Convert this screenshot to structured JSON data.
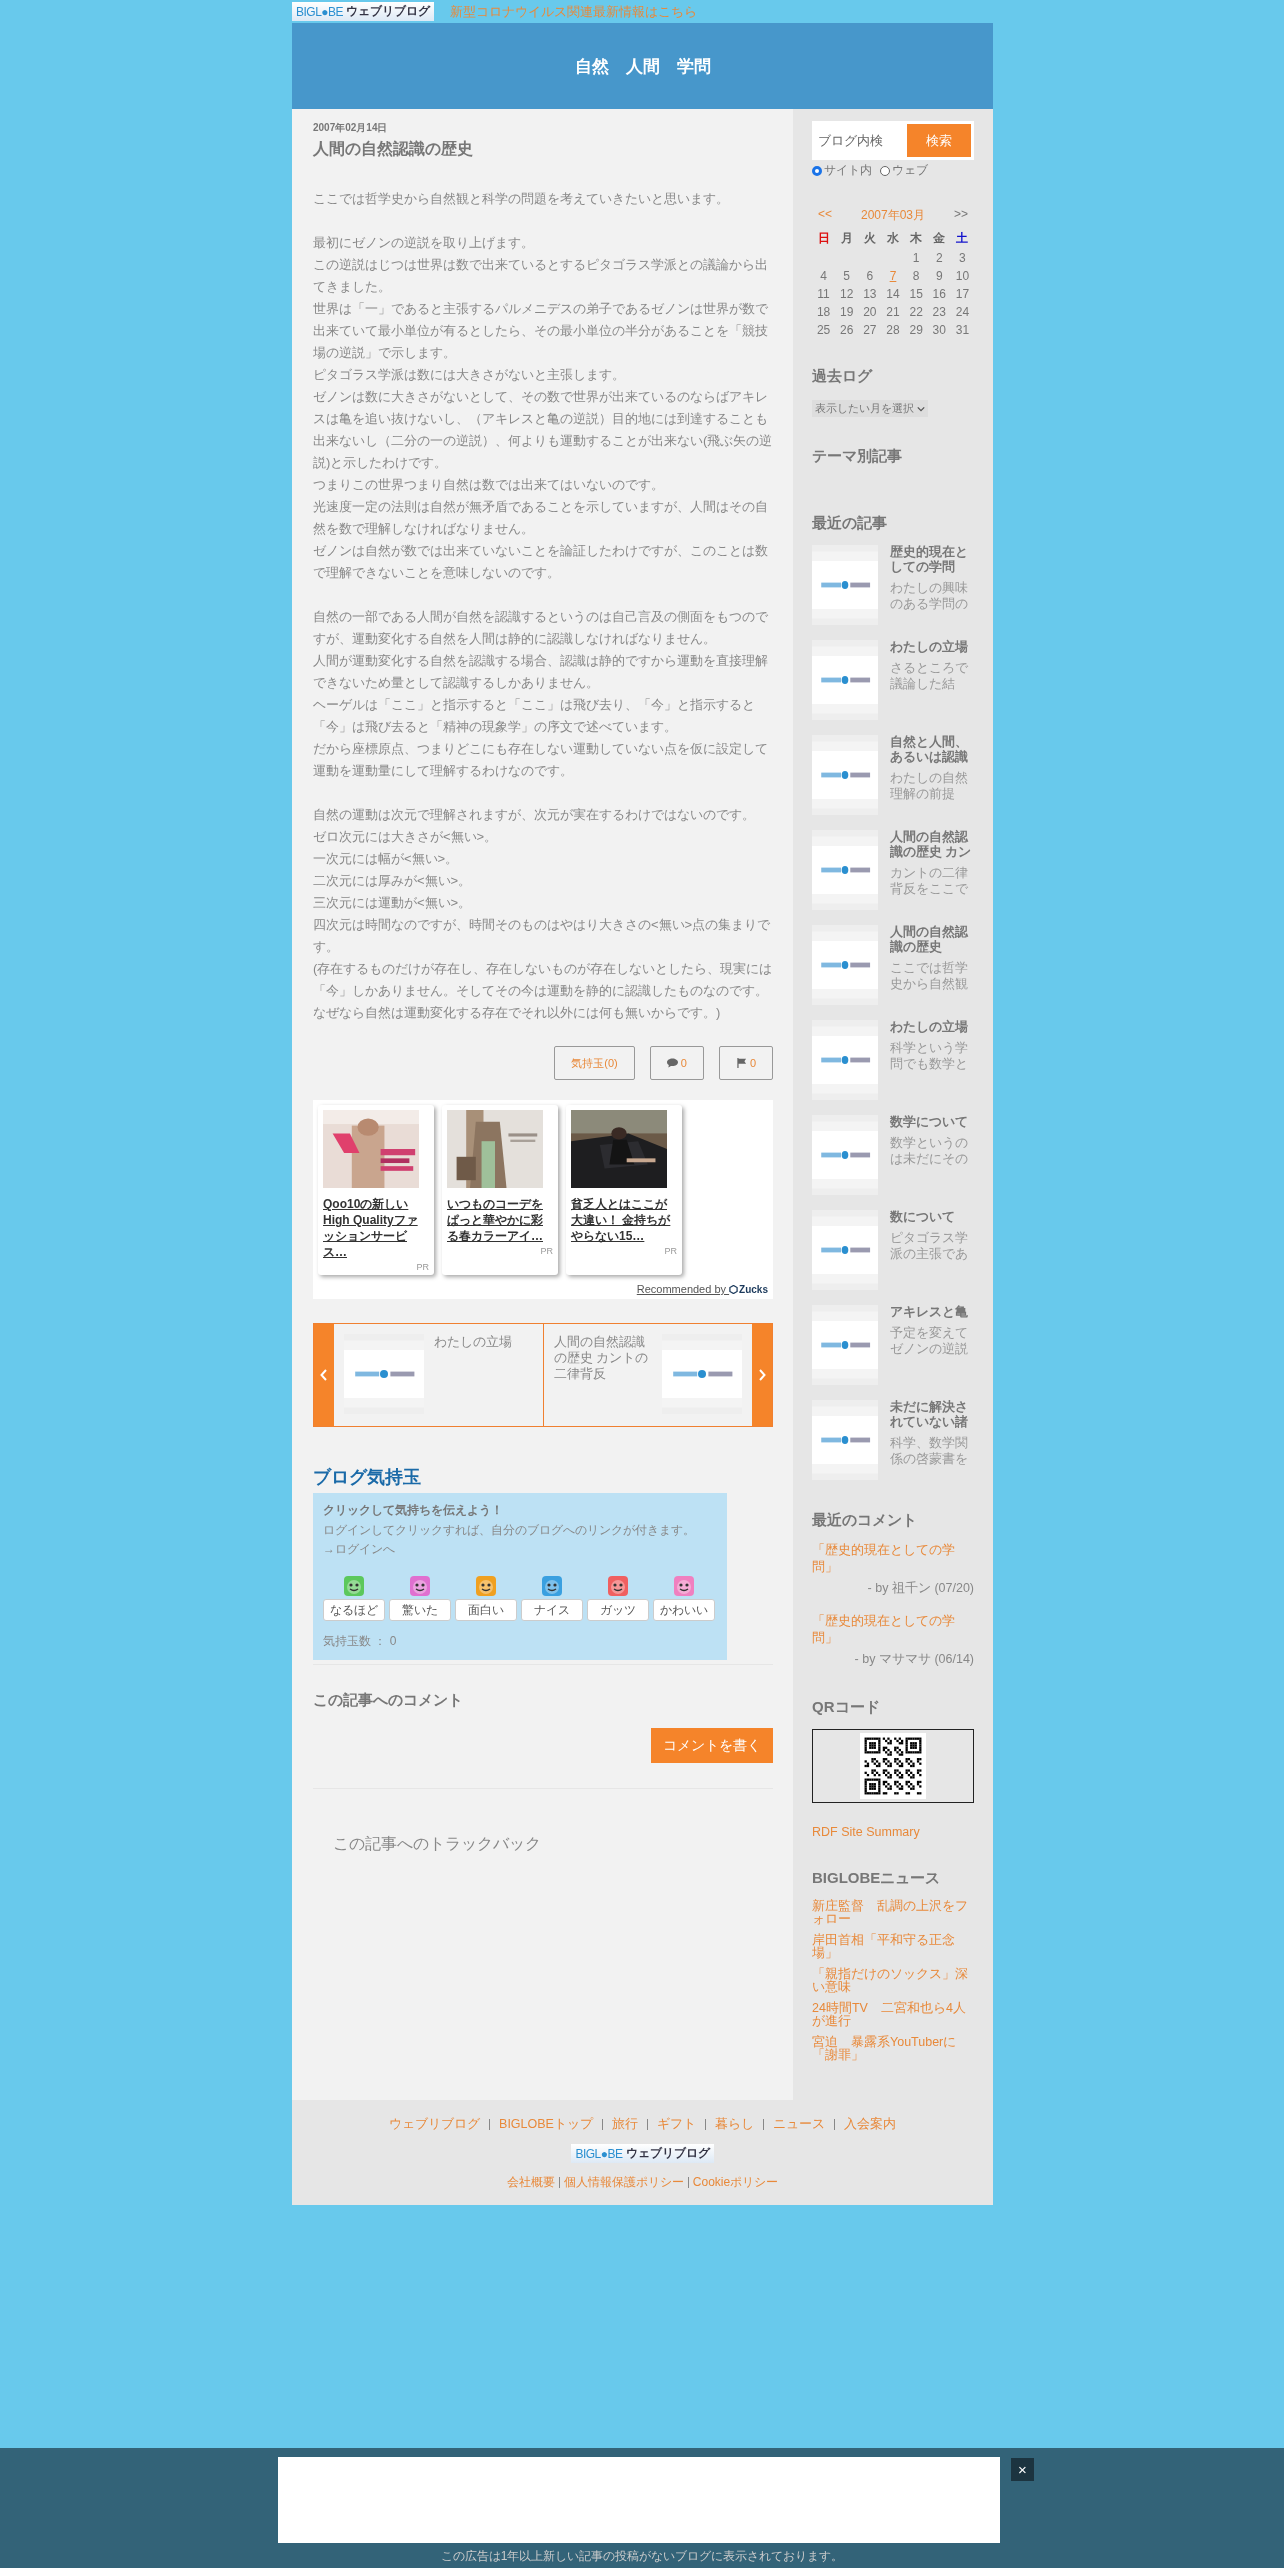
{
  "topbar": {
    "logo_brand": "BIGL●BE",
    "logo_product": "ウェブリブログ",
    "notice": "新型コロナウイルス関連最新情報はこちら"
  },
  "header": {
    "title": "自然　人間　学問"
  },
  "article": {
    "date": "2007年02月14日",
    "title": "人間の自然認識の歴史",
    "paragraphs": [
      [
        "ここでは哲学史から自然観と科学の問題を考えていきたいと思います。"
      ],
      [
        "最初にゼノンの逆説を取り上げます。",
        "この逆説はじつは世界は数で出来ているとするピタゴラス学派との議論から出てきました。",
        "世界は「一」であると主張するパルメニデスの弟子であるゼノンは世界が数で出来ていて最小単位が有るとしたら、その最小単位の半分があることを「競技場の逆説」で示します。",
        "ピタゴラス学派は数には大きさがないと主張します。",
        "ゼノンは数に大きさがないとして、その数で世界が出来ているのならばアキレスは亀を追い抜けないし、（アキレスと亀の逆説）目的地には到達することも出来ないし（二分の一の逆説）、何よりも運動することが出来ない(飛ぶ矢の逆説)と示したわけです。",
        "つまりこの世界つまり自然は数では出来てはいないのです。",
        "光速度一定の法則は自然が無矛盾であることを示していますが、人間はその自然を数で理解しなければなりません。",
        "ゼノンは自然が数では出来ていないことを論証したわけですが、このことは数で理解できないことを意味しないのです。"
      ],
      [
        "自然の一部である人間が自然を認識するというのは自己言及の側面をもつのですが、運動変化する自然を人間は静的に認識しなければなりません。",
        "人間が運動変化する自然を認識する場合、認識は静的ですから運動を直接理解できないため量として認識するしかありません。",
        "ヘーゲルは「ここ」と指示すると「ここ」は飛び去り、「今」と指示すると「今」は飛び去ると「精神の現象学」の序文で述べています。",
        "だから座標原点、つまりどこにも存在しない運動していない点を仮に設定して運動を運動量にして理解するわけなのです。"
      ],
      [
        "自然の運動は次元で理解されますが、次元が実在するわけではないのです。",
        "ゼロ次元には大きさが<無い>。",
        "一次元には幅が<無い>。",
        "二次元には厚みが<無い>。",
        "三次元には運動が<無い>。",
        "四次元は時間なのですが、時間そのものはやはり大きさの<無い>点の集まりです。",
        "(存在するものだけが存在し、存在しないものが存在しないとしたら、現実には「今」しかありません。そしてその今は運動を静的に認識したものなのです。なぜなら自然は運動変化する存在でそれ以外には何も無いからです。)"
      ]
    ],
    "actions": [
      {
        "kind": "kimochi",
        "label": "気持玉(0)"
      },
      {
        "kind": "comment",
        "label": "0"
      },
      {
        "kind": "trackback",
        "label": "0"
      }
    ]
  },
  "ads": {
    "cards": [
      {
        "title": "Qoo10の新しいHigh Qualityファッションサービス…",
        "tag": "PR"
      },
      {
        "title": "いつものコーデをぱっと華やかに彩る春カラーアイ…",
        "tag": "PR"
      },
      {
        "title": "貧乏人とはここが大違い！ 金持ちがやらない15…",
        "tag": "PR"
      }
    ],
    "credit": "Recommended by ",
    "credit_brand": "Zucks"
  },
  "carousel": [
    {
      "title": "わたしの立場"
    },
    {
      "title": "人間の自然認識の歴史 カントの二律背反"
    }
  ],
  "kimochi": {
    "title": "ブログ気持玉",
    "lead": "クリックして気持ちを伝えよう！",
    "note": "ログインしてクリックすれば、自分のブログへのリンクが付きます。",
    "login": "→ログインへ",
    "buttons": [
      {
        "label": "なるほど",
        "color": "#5cc85c"
      },
      {
        "label": "驚いた",
        "color": "#e070d0"
      },
      {
        "label": "面白い",
        "color": "#f0a020"
      },
      {
        "label": "ナイス",
        "color": "#3aa0e0"
      },
      {
        "label": "ガッツ",
        "color": "#f06060"
      },
      {
        "label": "かわいい",
        "color": "#f080c0"
      }
    ],
    "count": "気持玉数 ： 0"
  },
  "comments": {
    "title": "この記事へのコメント",
    "button": "コメントを書く"
  },
  "trackback": {
    "title": "この記事へのトラックバック"
  },
  "sidebar": {
    "search": {
      "placeholder": "ブログ内検",
      "button": "検索",
      "scopes": [
        {
          "label": "サイト内",
          "selected": true
        },
        {
          "label": "ウェブ",
          "selected": false
        }
      ]
    },
    "calendar": {
      "prev": "<<",
      "month": "2007年03月",
      "next": ">>",
      "weekdays": [
        {
          "label": "日",
          "kind": "sun"
        },
        {
          "label": "月",
          "kind": "day"
        },
        {
          "label": "火",
          "kind": "day"
        },
        {
          "label": "水",
          "kind": "day"
        },
        {
          "label": "木",
          "kind": "day"
        },
        {
          "label": "金",
          "kind": "day"
        },
        {
          "label": "土",
          "kind": "sat"
        }
      ],
      "weeks": [
        [
          {
            "day": "1",
            "link": false
          },
          {
            "day": "2",
            "link": false
          },
          {
            "day": "3",
            "link": false
          }
        ],
        [
          {
            "day": "4",
            "link": false
          },
          {
            "day": "5",
            "link": false
          },
          {
            "day": "6",
            "link": false
          },
          {
            "day": "7",
            "link": true
          },
          {
            "day": "8",
            "link": false
          },
          {
            "day": "9",
            "link": false
          },
          {
            "day": "10",
            "link": false
          }
        ],
        [
          {
            "day": "11",
            "link": false
          },
          {
            "day": "12",
            "link": false
          },
          {
            "day": "13",
            "link": false
          },
          {
            "day": "14",
            "link": false
          },
          {
            "day": "15",
            "link": false
          },
          {
            "day": "16",
            "link": false
          },
          {
            "day": "17",
            "link": false
          }
        ],
        [
          {
            "day": "18",
            "link": false
          },
          {
            "day": "19",
            "link": false
          },
          {
            "day": "20",
            "link": false
          },
          {
            "day": "21",
            "link": false
          },
          {
            "day": "22",
            "link": false
          },
          {
            "day": "23",
            "link": false
          },
          {
            "day": "24",
            "link": false
          }
        ],
        [
          {
            "day": "25",
            "link": false
          },
          {
            "day": "26",
            "link": false
          },
          {
            "day": "27",
            "link": false
          },
          {
            "day": "28",
            "link": false
          },
          {
            "day": "29",
            "link": false
          },
          {
            "day": "30",
            "link": false
          },
          {
            "day": "31",
            "link": false
          }
        ]
      ]
    },
    "archive": {
      "title": "過去ログ",
      "select": "表示したい月を選択"
    },
    "themes": {
      "title": "テーマ別記事"
    },
    "recent": {
      "title": "最近の記事",
      "items": [
        {
          "title": "歴史的現在としての学問",
          "excerpt": "わたしの興味のある学問の"
        },
        {
          "title": "わたしの立場",
          "excerpt": "さるところで議論した結"
        },
        {
          "title": "自然と人間、あるいは認識",
          "excerpt": "わたしの自然理解の前提"
        },
        {
          "title": "人間の自然認識の歴史 カン",
          "excerpt": "カントの二律背反をここで"
        },
        {
          "title": "人間の自然認識の歴史",
          "excerpt": "ここでは哲学史から自然観"
        },
        {
          "title": "わたしの立場",
          "excerpt": "科学という学問でも数学と"
        },
        {
          "title": "数学について",
          "excerpt": "数学というのは未だにその"
        },
        {
          "title": "数について",
          "excerpt": "ピタゴラス学派の主張であ"
        },
        {
          "title": "アキレスと亀",
          "excerpt": "予定を変えてゼノンの逆説"
        },
        {
          "title": "未だに解決されていない諸",
          "excerpt": "科学、数学関係の啓蒙書を"
        }
      ]
    },
    "recent_comments": {
      "title": "最近のコメント",
      "items": [
        {
          "link": "「歴史的現在としての学問」",
          "by": "- by 祖千ン (07/20)"
        },
        {
          "link": "「歴史的現在としての学問」",
          "by": "- by マサマサ (06/14)"
        }
      ]
    },
    "qr": {
      "title": "QRコード"
    },
    "rdf": "RDF Site Summary",
    "news": {
      "title": "BIGLOBEニュース",
      "items": [
        "新庄監督　乱調の上沢をフォロー",
        "岸田首相「平和守る正念場」",
        "「親指だけのソックス」深い意味",
        "24時間TV　二宮和也ら4人が進行",
        "宮迫　暴露系YouTuberに「謝罪」"
      ]
    }
  },
  "footer": {
    "links": [
      "ウェブリブログ",
      "BIGLOBEトップ",
      "旅行",
      "ギフト",
      "暮らし",
      "ニュース",
      "入会案内"
    ],
    "logo_brand": "BIGL●BE",
    "logo_product": "ウェブリブログ",
    "policies": [
      "会社概要",
      "個人情報保護ポリシー",
      "Cookieポリシー"
    ]
  },
  "bottom_ad": {
    "close": "×",
    "notice": "この広告は1年以上新しい記事の投稿がないブログに表示されております。"
  }
}
